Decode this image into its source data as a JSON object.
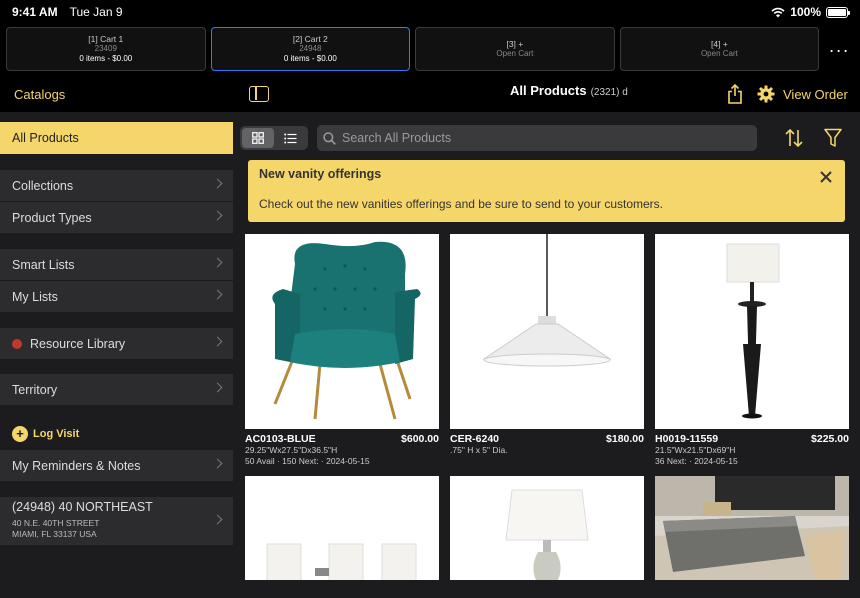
{
  "status_bar": {
    "time": "9:41 AM",
    "date": "Tue Jan 9",
    "battery": "100%"
  },
  "carts": [
    {
      "title": "[1] Cart 1",
      "sub": "23409",
      "items": "0 items - $0.00",
      "active": false
    },
    {
      "title": "[2] Cart 2",
      "sub": "24948",
      "items": "0 items - $0.00",
      "active": true
    },
    {
      "title": "[3] +",
      "sub": "Open Cart",
      "items": "",
      "active": false
    },
    {
      "title": "[4] +",
      "sub": "Open Cart",
      "items": "",
      "active": false
    }
  ],
  "more_label": "···",
  "nav": {
    "catalogs": "Catalogs",
    "title": "All Products",
    "count": "(2321) d",
    "view_order": "View Order"
  },
  "sidebar": {
    "all_products": "All Products",
    "collections": "Collections",
    "product_types": "Product Types",
    "smart_lists": "Smart Lists",
    "my_lists": "My Lists",
    "resource_library": "Resource Library",
    "territory": "Territory",
    "log_visit": "Log Visit",
    "reminders": "My Reminders & Notes",
    "customer": {
      "name": "(24948) 40 NORTHEAST",
      "address1": "40 N.E. 40TH STREET",
      "address2": "MIAMI, FL 33137 USA"
    }
  },
  "search": {
    "placeholder": "Search All Products"
  },
  "banner": {
    "title": "New vanity offerings",
    "message": "Check out the new vanities offerings and be sure to send to your customers."
  },
  "products": [
    {
      "sku": "AC0103-BLUE",
      "price": "$600.00",
      "dims": "29.25\"Wx27.5\"Dx36.5\"H",
      "avail": "50 Avail · 150 Next: · 2024-05-15",
      "kind": "chair"
    },
    {
      "sku": "CER-6240",
      "price": "$180.00",
      "dims": ".75\" H x 5\" Dia.",
      "avail": "",
      "kind": "pendant"
    },
    {
      "sku": "H0019-11559",
      "price": "$225.00",
      "dims": "21.5\"Wx21.5\"Dx69\"H",
      "avail": "36 Next: · 2024-05-15",
      "kind": "floor-lamp"
    },
    {
      "sku": "",
      "price": "",
      "dims": "",
      "avail": "",
      "kind": "vanity-lights"
    },
    {
      "sku": "",
      "price": "",
      "dims": "",
      "avail": "",
      "kind": "table-lamp"
    },
    {
      "sku": "",
      "price": "",
      "dims": "",
      "avail": "",
      "kind": "coffee-table"
    }
  ],
  "colors": {
    "accent": "#f5d66b",
    "active_cart_border": "#2f7cf6",
    "resource_dot": "#c0392b"
  }
}
